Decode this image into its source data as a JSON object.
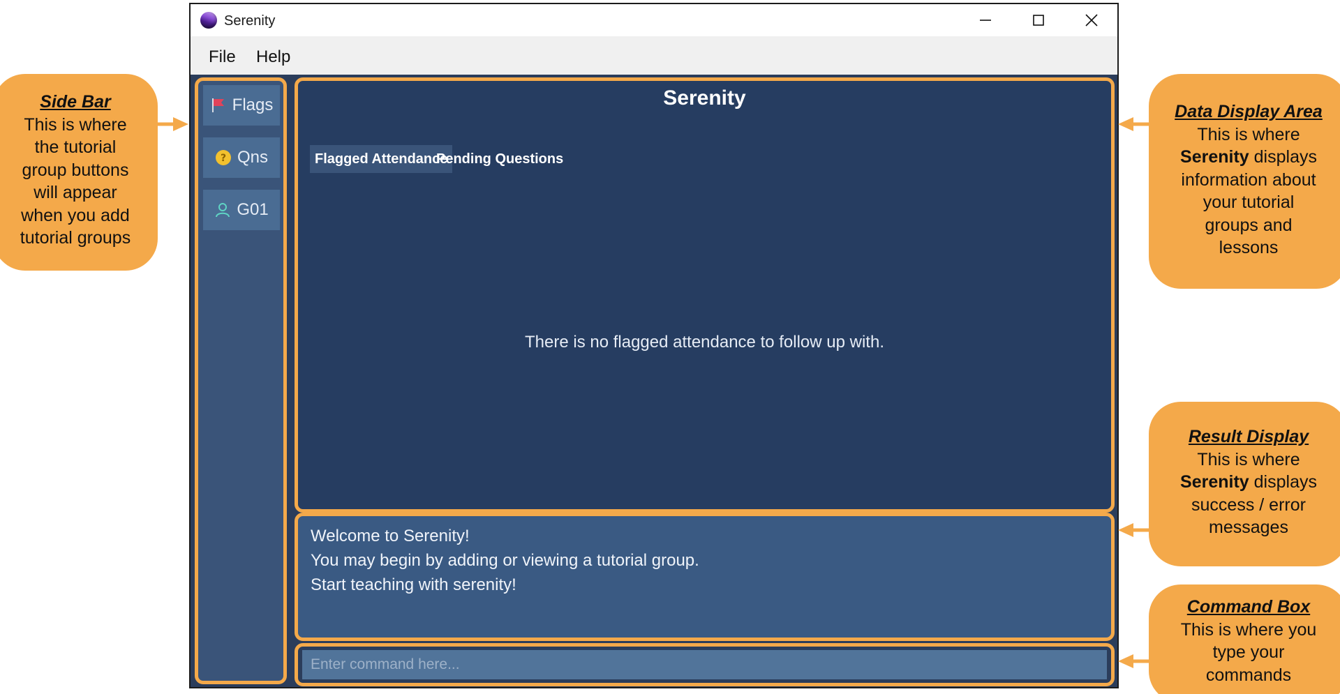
{
  "window": {
    "title": "Serenity",
    "menu": [
      "File",
      "Help"
    ]
  },
  "sidebar": {
    "items": [
      {
        "label": "Flags",
        "icon": "flag-icon"
      },
      {
        "label": "Qns",
        "icon": "question-icon"
      },
      {
        "label": "G01",
        "icon": "person-icon"
      }
    ]
  },
  "display": {
    "title": "Serenity",
    "tabs": [
      "Flagged Attendance",
      "Pending Questions"
    ],
    "active_tab": "Flagged Attendance",
    "empty_message": "There is no flagged attendance to follow up with."
  },
  "result": {
    "lines": [
      "Welcome to Serenity!",
      "You may begin by adding or viewing a tutorial group.",
      "Start teaching with serenity!"
    ]
  },
  "command": {
    "placeholder": "Enter command here..."
  },
  "callouts": {
    "side_bar": {
      "heading": "Side Bar",
      "lines": [
        "This is where",
        "the tutorial",
        "group buttons",
        "will appear",
        "when you add",
        "tutorial groups"
      ]
    },
    "data_display": {
      "heading": "Data Display Area",
      "line1": "This is where",
      "bold": "Serenity",
      "line2_rest": " displays",
      "lines": [
        "information about",
        "your tutorial",
        "groups and",
        "lessons"
      ]
    },
    "result_display": {
      "heading": "Result Display",
      "line1": "This is where",
      "bold": "Serenity",
      "line2_rest": " displays",
      "lines": [
        "success / error",
        "messages"
      ]
    },
    "command_box": {
      "heading": "Command Box",
      "lines": [
        "This is where you",
        "type your",
        "commands"
      ]
    }
  },
  "colors": {
    "accent": "#f4a94a",
    "app_background": "#2b3d5b",
    "sidebar_button": "#4a6c93"
  }
}
